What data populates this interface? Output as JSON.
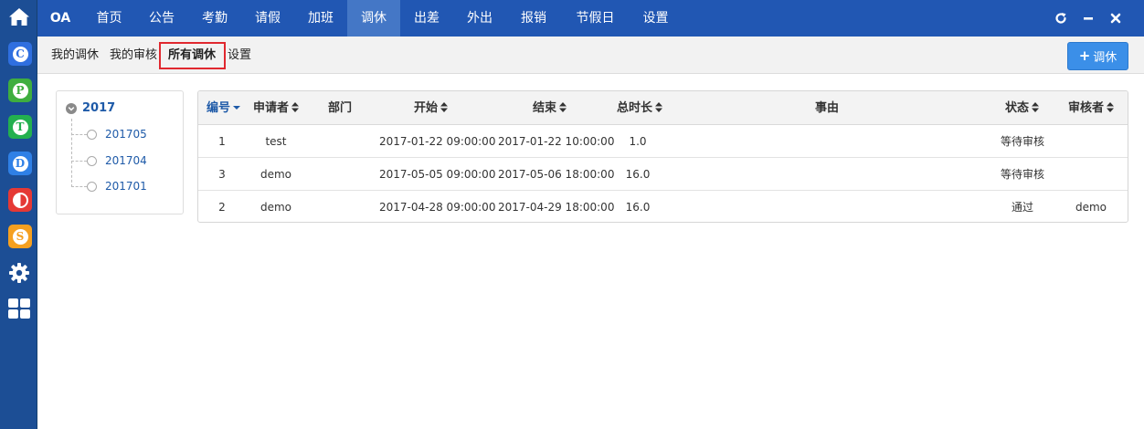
{
  "topnav": {
    "brand": "OA",
    "items": [
      "首页",
      "公告",
      "考勤",
      "请假",
      "加班",
      "调休",
      "出差",
      "外出",
      "报销",
      "节假日",
      "设置"
    ],
    "active": "调休"
  },
  "window_controls": [
    "refresh-icon",
    "minimize-icon",
    "close-icon"
  ],
  "rail": {
    "icons": [
      {
        "name": "home-icon"
      },
      {
        "name": "app-c-icon",
        "letter": "C",
        "color": "#2f6fe0"
      },
      {
        "name": "app-p-icon",
        "letter": "P",
        "color": "#3fae3f"
      },
      {
        "name": "app-t-icon",
        "letter": "T",
        "color": "#23b04f"
      },
      {
        "name": "app-d-icon",
        "letter": "D",
        "color": "#2f80e6"
      },
      {
        "name": "app-half-icon",
        "letter": "",
        "color": "#e53935"
      },
      {
        "name": "app-s-icon",
        "letter": "S",
        "color": "#f5a020"
      },
      {
        "name": "gear-icon"
      },
      {
        "name": "grid-icon"
      }
    ]
  },
  "subnav": {
    "tabs": [
      "我的调休",
      "我的审核",
      "所有调休",
      "设置"
    ],
    "active": "所有调休",
    "add_button": "调休"
  },
  "tree": {
    "root": "2017",
    "children": [
      "201705",
      "201704",
      "201701"
    ]
  },
  "table": {
    "headers": [
      "编号",
      "申请者",
      "部门",
      "开始",
      "结束",
      "总时长",
      "事由",
      "状态",
      "审核者"
    ],
    "rows": [
      {
        "id": "1",
        "applicant": "test",
        "dept": "",
        "start": "2017-01-22 09:00:00",
        "end": "2017-01-22 10:00:00",
        "duration": "1.0",
        "reason": "",
        "status": "等待审核",
        "reviewer": ""
      },
      {
        "id": "3",
        "applicant": "demo",
        "dept": "",
        "start": "2017-05-05 09:00:00",
        "end": "2017-05-06 18:00:00",
        "duration": "16.0",
        "reason": "",
        "status": "等待审核",
        "reviewer": ""
      },
      {
        "id": "2",
        "applicant": "demo",
        "dept": "",
        "start": "2017-04-28 09:00:00",
        "end": "2017-04-29 18:00:00",
        "duration": "16.0",
        "reason": "",
        "status": "通过",
        "reviewer": "demo"
      }
    ]
  },
  "colors": {
    "topbar": "#2157b3",
    "rail": "#1c4e95",
    "active_tab": "#4477c6",
    "link": "#1e5aa8",
    "pass": "#2aa12a",
    "highlight": "#e0282f",
    "add_button": "#3b8fe8"
  }
}
